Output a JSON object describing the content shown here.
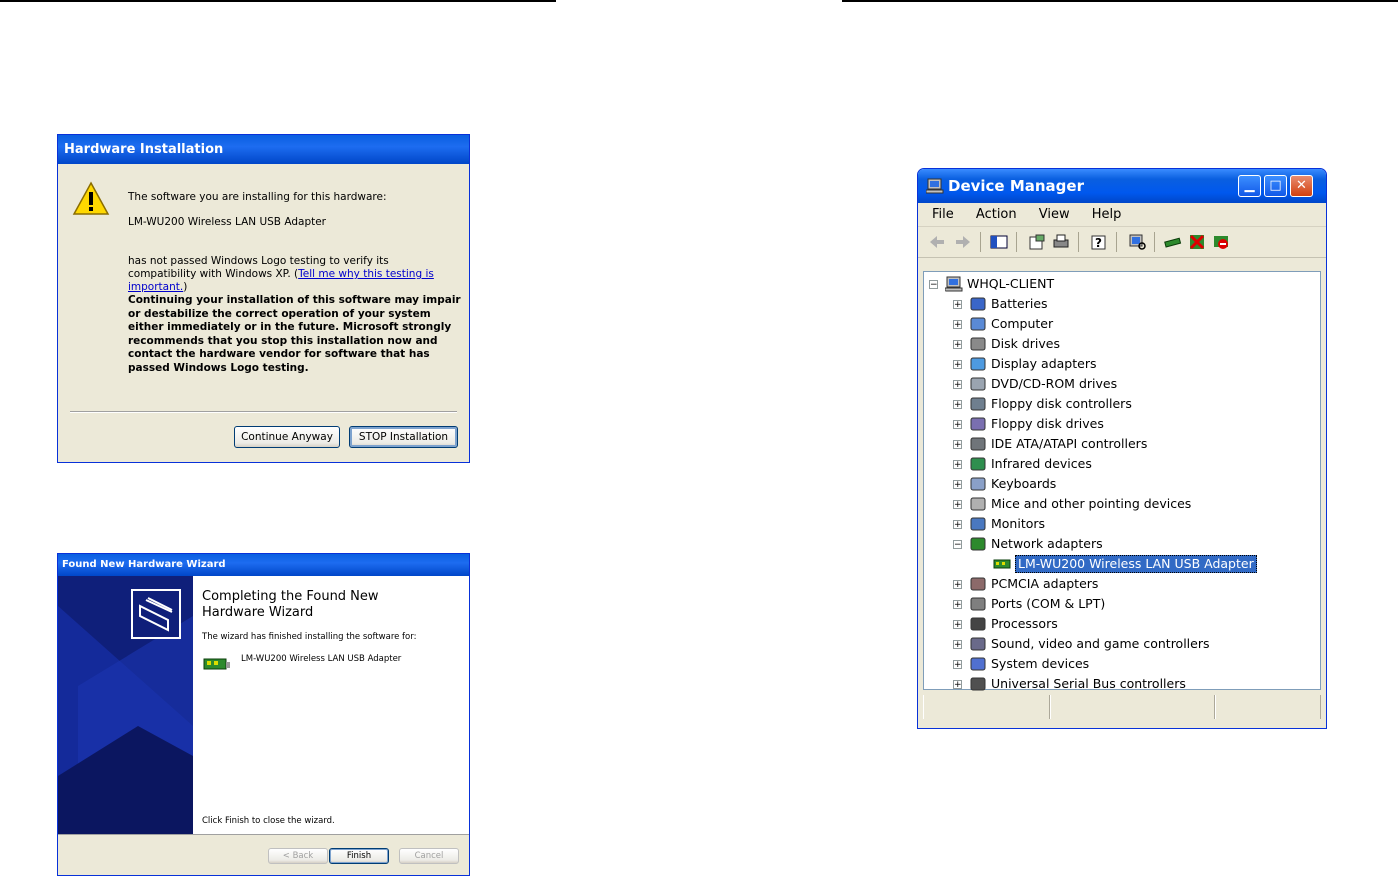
{
  "hardware_installation": {
    "title": "Hardware Installation",
    "line1": "The software you are installing for this hardware:",
    "device": "LM-WU200 Wireless LAN USB Adapter",
    "line3": "has not passed Windows Logo testing to verify its compatibility with Windows XP.",
    "link": "Tell me why this testing is important.",
    "warning": "Continuing your installation of this software may impair or destabilize the correct operation of your system either immediately or in the future. Microsoft strongly recommends that you stop this installation now and contact the hardware vendor for software that has passed Windows Logo testing.",
    "continue_button": "Continue Anyway",
    "stop_button": "STOP Installation"
  },
  "wizard": {
    "title": "Found New Hardware Wizard",
    "heading": "Completing the Found New Hardware Wizard",
    "sub": "The wizard has finished installing the software for:",
    "device": "LM-WU200 Wireless LAN USB Adapter",
    "finish_msg": "Click Finish to close the wizard.",
    "back_button": "< Back",
    "finish_button": "Finish",
    "cancel_button": "Cancel"
  },
  "device_manager": {
    "title": "Device Manager",
    "menu": [
      "File",
      "Action",
      "View",
      "Help"
    ],
    "root": "WHQL-CLIENT",
    "categories": [
      "Batteries",
      "Computer",
      "Disk drives",
      "Display adapters",
      "DVD/CD-ROM drives",
      "Floppy disk controllers",
      "Floppy disk drives",
      "IDE ATA/ATAPI controllers",
      "Infrared devices",
      "Keyboards",
      "Mice and other pointing devices",
      "Monitors",
      "Network adapters",
      "PCMCIA adapters",
      "Ports (COM & LPT)",
      "Processors",
      "Sound, video and game controllers",
      "System devices",
      "Universal Serial Bus controllers"
    ],
    "selected_device": "LM-WU200 Wireless LAN USB Adapter",
    "expanded_category": "Network adapters"
  },
  "colors": {
    "xp_title_blue": "#0a5fe0",
    "selection_blue": "#316ac5",
    "dialog_face": "#ece9d8"
  }
}
